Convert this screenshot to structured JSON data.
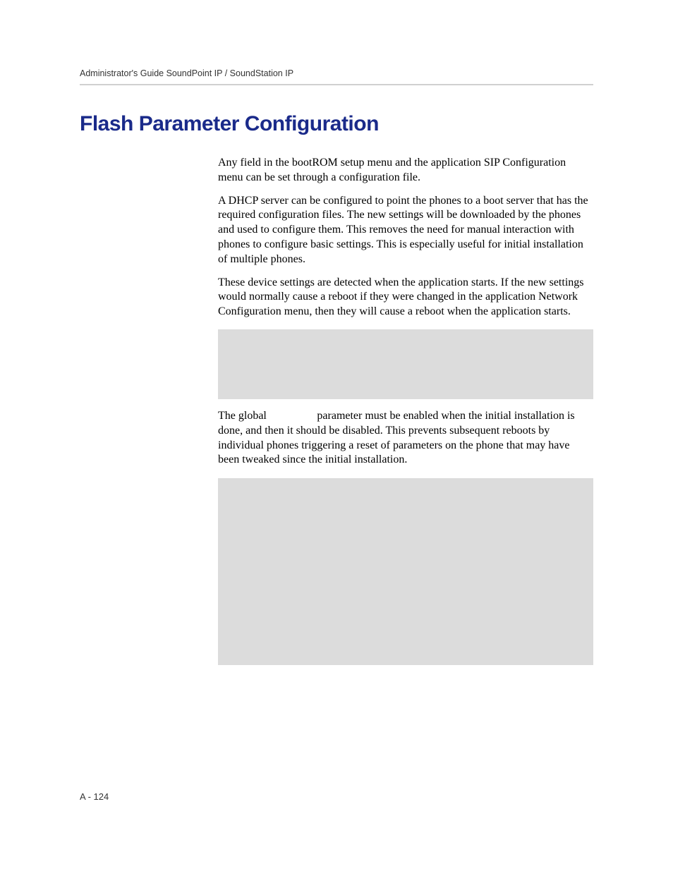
{
  "header": {
    "breadcrumb": "Administrator's Guide SoundPoint IP / SoundStation IP"
  },
  "section": {
    "title": "Flash Parameter Configuration"
  },
  "paragraphs": {
    "p1": "Any field in the bootROM setup menu and the application SIP Configuration menu can be set through a configuration file.",
    "p2": "A DHCP server can be configured to point the phones to a boot server that has the required configuration files. The new settings will be downloaded by the phones and used to configure them. This removes the need for manual interaction with phones to configure basic settings. This is especially useful for initial installation of multiple phones.",
    "p3": "These device settings are detected when the application starts. If the new settings would normally cause a reboot if they were changed in the application Network Configuration menu, then they will cause a reboot when the application starts.",
    "p4_part1": "The global ",
    "p4_part2": " parameter must be enabled when the initial installation is done, and then it should be disabled. This prevents subsequent reboots by individual phones triggering a reset of parameters on the phone that may have been tweaked since the initial installation."
  },
  "footer": {
    "pageNumber": "A - 124"
  }
}
